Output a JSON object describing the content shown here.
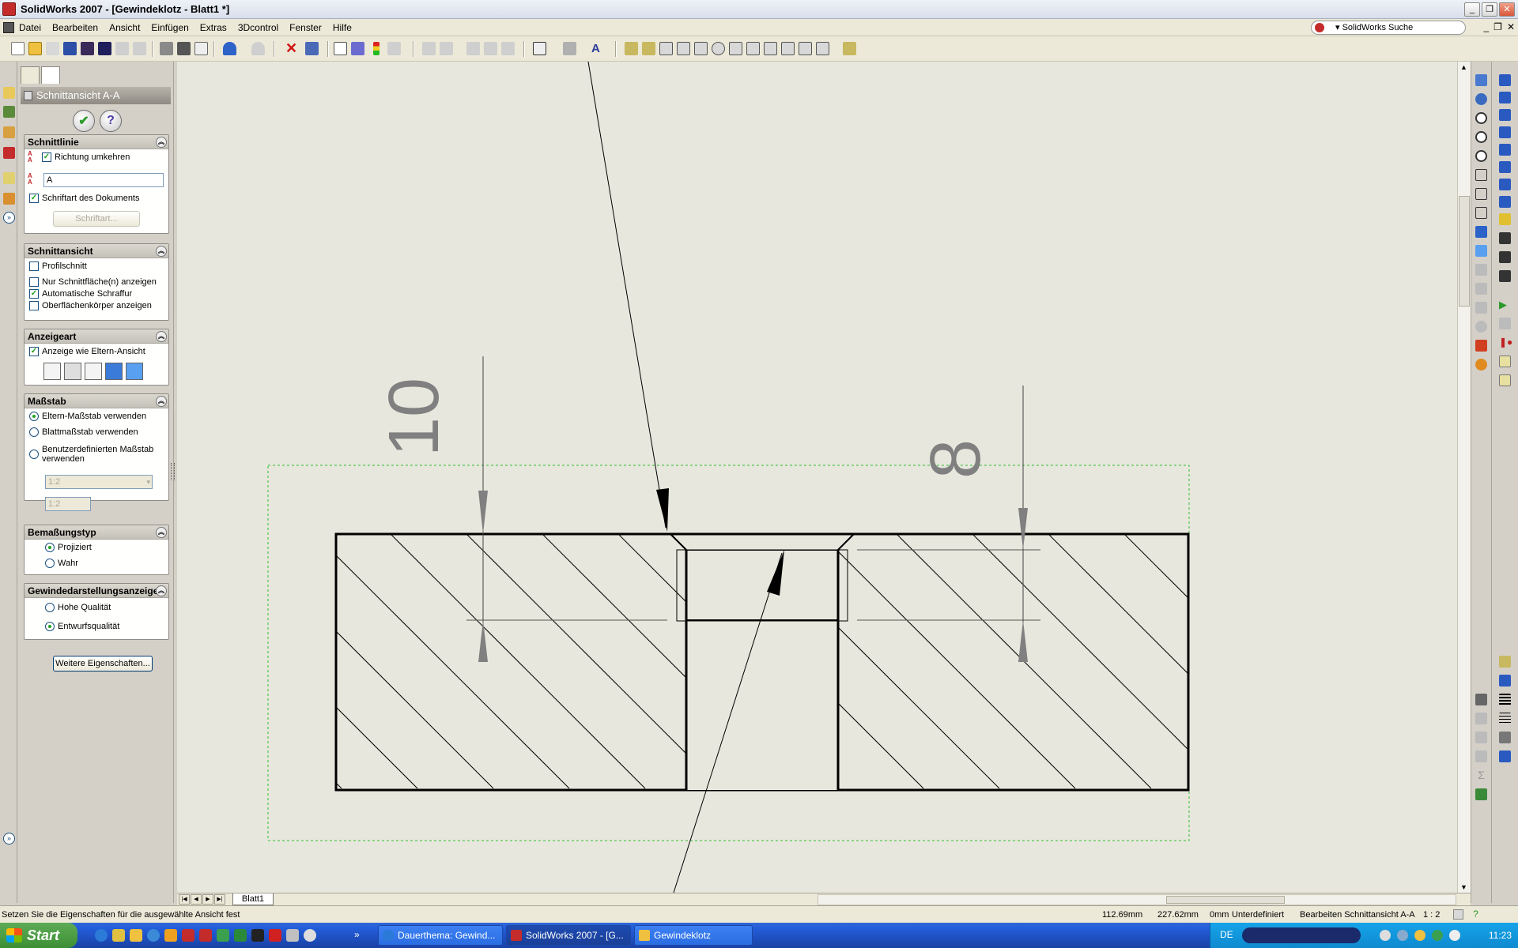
{
  "window": {
    "title": "SolidWorks 2007 - [Gewindeklotz - Blatt1 *]",
    "min": "_",
    "restore": "❐",
    "close": "✕"
  },
  "menubar": {
    "items": [
      "Datei",
      "Bearbeiten",
      "Ansicht",
      "Einfügen",
      "Extras",
      "3Dcontrol",
      "Fenster",
      "Hilfe"
    ],
    "search_label": "▾ SolidWorks Suche",
    "mdi_min": "_",
    "mdi_restore": "❐",
    "mdi_close": "✕"
  },
  "property_manager": {
    "title": "Schnittansicht A-A",
    "ok": "✔",
    "help": "?",
    "groups": {
      "schnittlinie": {
        "title": "Schnittlinie",
        "richtung_umkehren": "Richtung umkehren",
        "label_value": "A",
        "schriftart_dokument": "Schriftart des Dokuments",
        "schriftart_button": "Schriftart..."
      },
      "schnittansicht": {
        "title": "Schnittansicht",
        "profilschnitt": "Profilschnitt",
        "nur_schnittflaeche": "Nur Schnittfläche(n) anzeigen",
        "auto_schraffur": "Automatische Schraffur",
        "oberflaechen": "Oberflächenkörper anzeigen"
      },
      "anzeigeart": {
        "title": "Anzeigeart",
        "wie_eltern": "Anzeige wie Eltern-Ansicht"
      },
      "massstab": {
        "title": "Maßstab",
        "eltern": "Eltern-Maßstab verwenden",
        "blatt": "Blattmaßstab verwenden",
        "benutzer": "Benutzerdefinierten Maßstab",
        "benutzer2": "verwenden",
        "select_value": "1:2",
        "input_value": "1:2"
      },
      "bemassungstyp": {
        "title": "Bemaßungstyp",
        "projiziert": "Projiziert",
        "wahr": "Wahr"
      },
      "gewinde": {
        "title": "Gewindedarstellungsanzeige",
        "hohe": "Hohe Qualität",
        "entwurf": "Entwurfsqualität"
      }
    },
    "weitere": "Weitere Eigenschaften..."
  },
  "drawing": {
    "dim_left": "10",
    "dim_right": "8"
  },
  "sheet_tab": "Blatt1",
  "statusbar": {
    "hint": "Setzen Sie die Eigenschaften für die ausgewählte Ansicht fest",
    "x": "112.69mm",
    "y": "227.62mm",
    "z": "0mm",
    "state": "Unterdefiniert",
    "mode": "Bearbeiten Schnittansicht A-A",
    "scale": "1 : 2"
  },
  "taskbar": {
    "start": "Start",
    "tasks": [
      "Dauerthema: Gewind...",
      "SolidWorks 2007 - [G...",
      "Gewindeklotz"
    ],
    "lang": "DE",
    "clock": "11:23"
  },
  "colors": {
    "hatch": "#000000",
    "border_dashed": "#2fbf2f",
    "arrow": "#808080"
  }
}
